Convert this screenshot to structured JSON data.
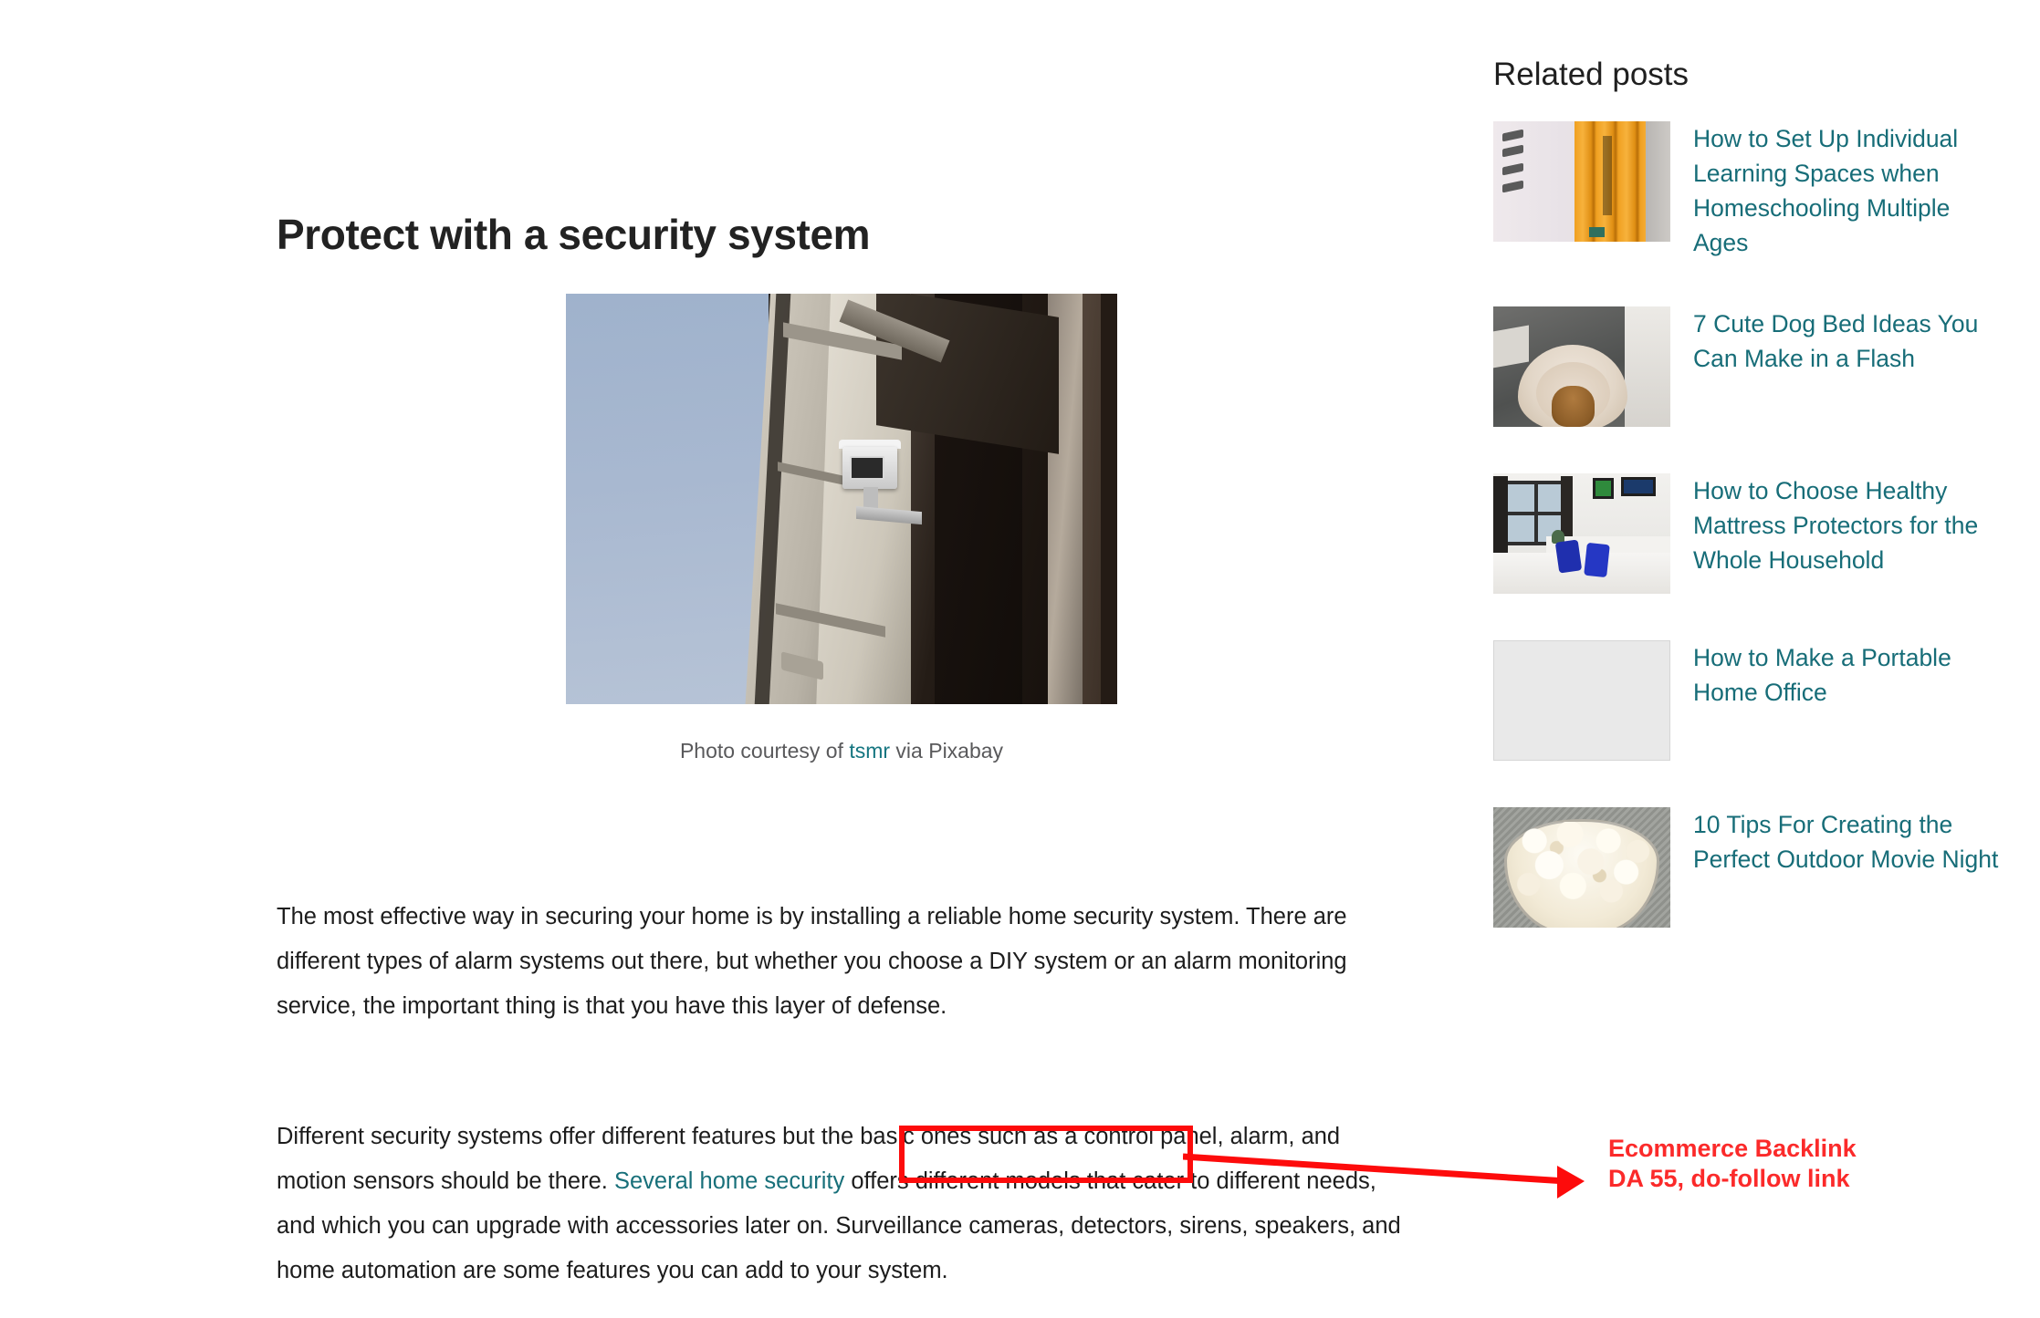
{
  "article": {
    "title": "Protect with a security system",
    "figure": {
      "image_alt": "security-camera-on-building-facade",
      "caption_prefix": "Photo courtesy of ",
      "caption_link": "tsmr",
      "caption_suffix": " via Pixabay"
    },
    "paragraph_1": "The most effective way in securing your home is by installing a reliable home security system. There are different types of alarm systems out there, but whether you choose a DIY system or an alarm monitoring service, the important thing is that you have this layer of defense.",
    "paragraph_2": {
      "before_link": "Different security systems offer different features but the basic ones such as a control panel, alarm, and motion sensors should be there. ",
      "link_text": "Several home security",
      "after_link": " offers different models that cater to different needs, and which you can upgrade with accessories later on. Surveillance cameras, detectors, sirens, speakers, and home automation are some features you can add to your system."
    }
  },
  "annotation": {
    "line_1": "Ecommerce Backlink",
    "line_2": "DA 55, do-follow link",
    "color": "#fb2a2a",
    "box_color": "#fd0b0b"
  },
  "sidebar": {
    "title": "Related posts",
    "link_color": "#176d78",
    "items": [
      {
        "label": "How to Set Up Individual Learning Spaces when Homeschooling Multiple Ages",
        "thumb": "pencils-notebook-thumbnail"
      },
      {
        "label": "7 Cute Dog Bed Ideas You Can Make in a Flash",
        "thumb": "dog-bed-thumbnail"
      },
      {
        "label": "How to Choose Healthy Mattress Protectors for the Whole Household",
        "thumb": "bedroom-mattress-thumbnail"
      },
      {
        "label": "How to Make a Portable Home Office",
        "thumb": "placeholder-thumbnail"
      },
      {
        "label": "10 Tips For Creating the Perfect Outdoor Movie Night",
        "thumb": "popcorn-bowl-thumbnail"
      }
    ]
  }
}
